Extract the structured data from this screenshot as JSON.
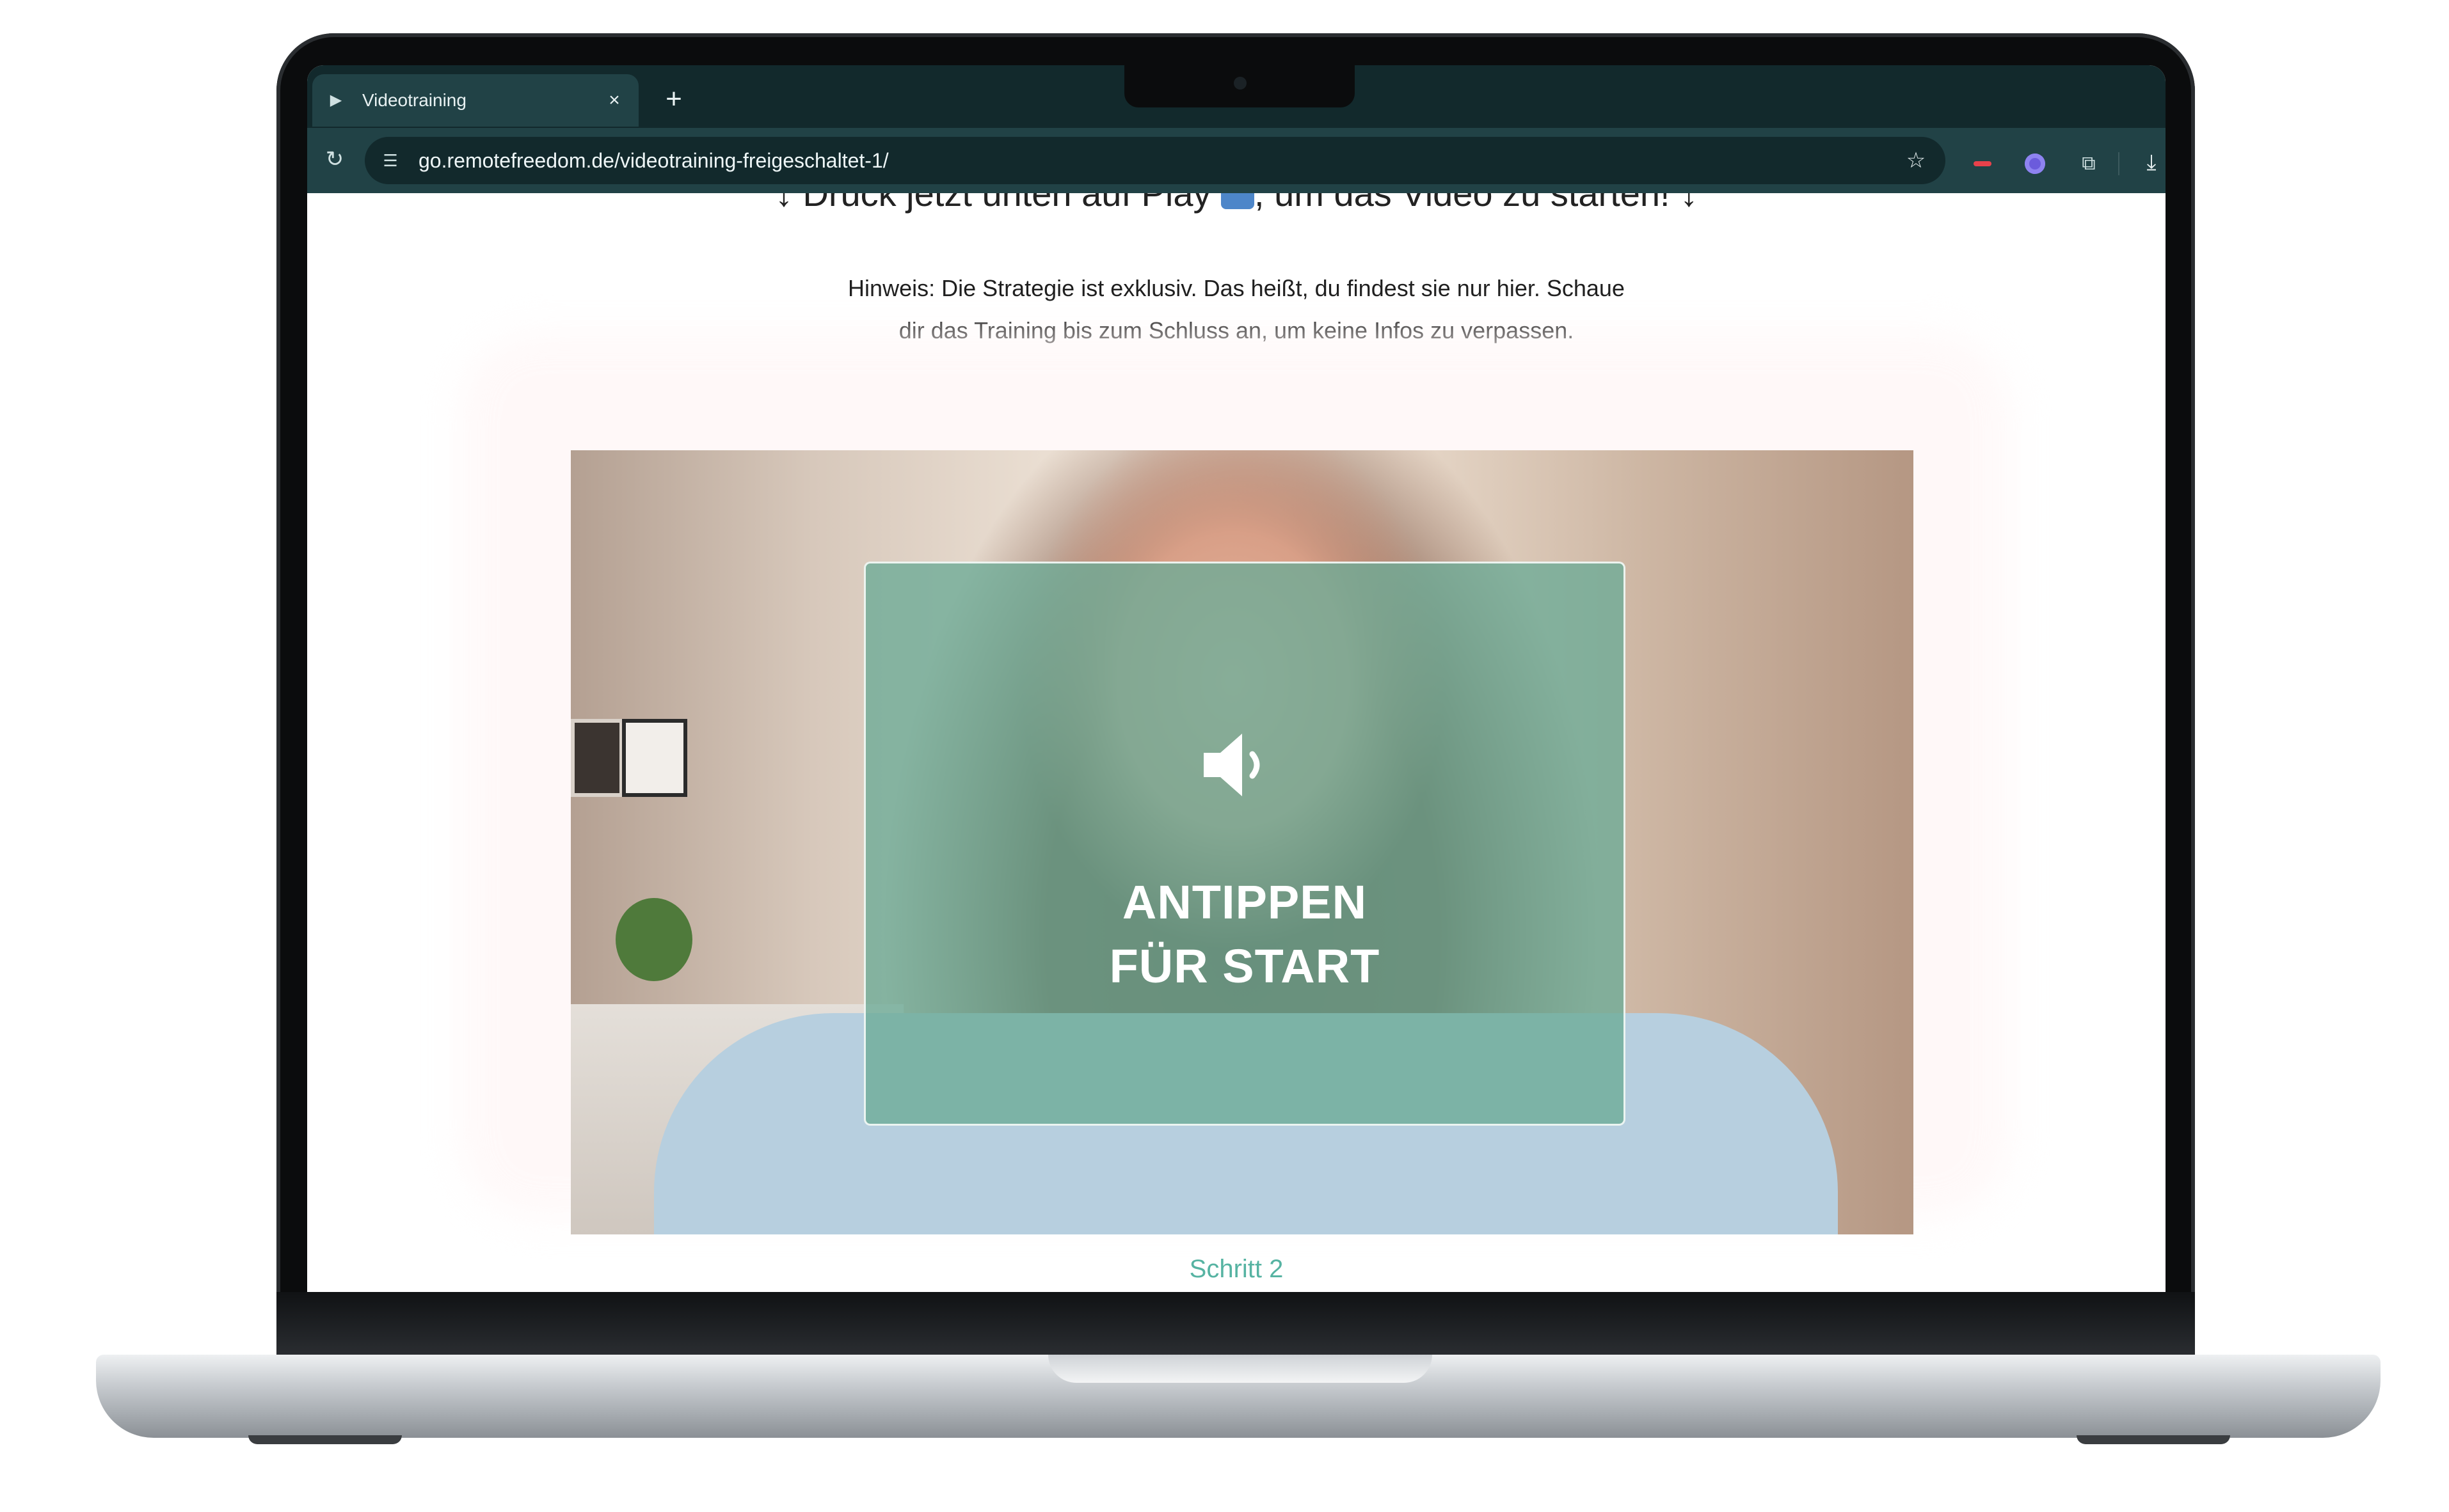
{
  "browser": {
    "tab_title": "Videotraining",
    "tab_close": "×",
    "new_tab": "+",
    "url": "go.remotefreedom.de/videotraining-freigeschaltet-1/"
  },
  "page": {
    "headline_left": "↓ Druck jetzt unten auf Play ",
    "headline_right": ", um das Video zu starten! ↓",
    "note_line1": "Hinweis: Die Strategie ist exklusiv. Das heißt, du findest sie nur hier. Schaue",
    "note_line2": "dir das Training bis zum Schluss an, um keine Infos zu verpassen.",
    "overlay_line1": "ANTIPPEN",
    "overlay_line2": "FÜR START",
    "step_label": "Schritt 2"
  },
  "icons": {
    "tab_favicon": "video-favicon-icon",
    "reload": "reload-icon",
    "site_info": "site-info-icon",
    "bookmark": "star-icon",
    "extensions": "puzzle-icon",
    "download": "download-icon",
    "sound": "speaker-icon"
  },
  "colors": {
    "chrome_dark": "#12292c",
    "chrome_toolbar": "#214246",
    "overlay_green": "#6cab96",
    "step_teal": "#56b3a2"
  }
}
